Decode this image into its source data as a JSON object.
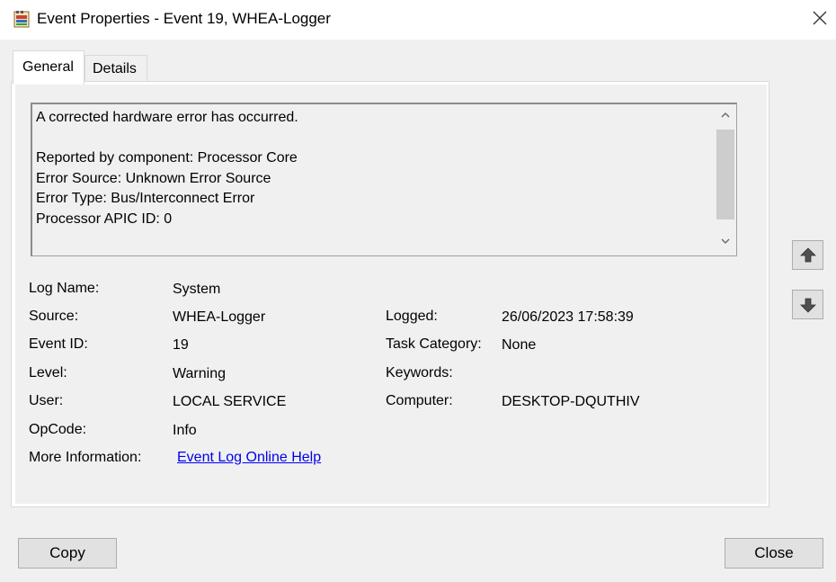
{
  "window": {
    "title": "Event Properties - Event 19, WHEA-Logger"
  },
  "tabs": {
    "general": "General",
    "details": "Details"
  },
  "description": {
    "text": "A corrected hardware error has occurred.\n\nReported by component: Processor Core\nError Source: Unknown Error Source\nError Type: Bus/Interconnect Error\nProcessor APIC ID: 0"
  },
  "fields": {
    "log_name": {
      "label": "Log Name:",
      "value": "System"
    },
    "source": {
      "label": "Source:",
      "value": "WHEA-Logger"
    },
    "logged": {
      "label": "Logged:",
      "value": "26/06/2023 17:58:39"
    },
    "event_id": {
      "label": "Event ID:",
      "value": "19"
    },
    "task_category": {
      "label": "Task Category:",
      "value": "None"
    },
    "level": {
      "label": "Level:",
      "value": "Warning"
    },
    "keywords": {
      "label": "Keywords:",
      "value": ""
    },
    "user": {
      "label": "User:",
      "value": "LOCAL SERVICE"
    },
    "computer": {
      "label": "Computer:",
      "value": "DESKTOP-DQUTHIV"
    },
    "opcode": {
      "label": "OpCode:",
      "value": "Info"
    },
    "more_info": {
      "label": "More Information:",
      "link": "Event Log Online Help"
    }
  },
  "buttons": {
    "copy": "Copy",
    "close": "Close"
  },
  "icons": {
    "app": "event-properties-icon",
    "close": "close-icon",
    "up": "arrow-up-icon",
    "down": "arrow-down-icon"
  },
  "colors": {
    "link": "#0000ee",
    "window_bg": "#f0f0f0",
    "button_bg": "#e1e1e1"
  }
}
